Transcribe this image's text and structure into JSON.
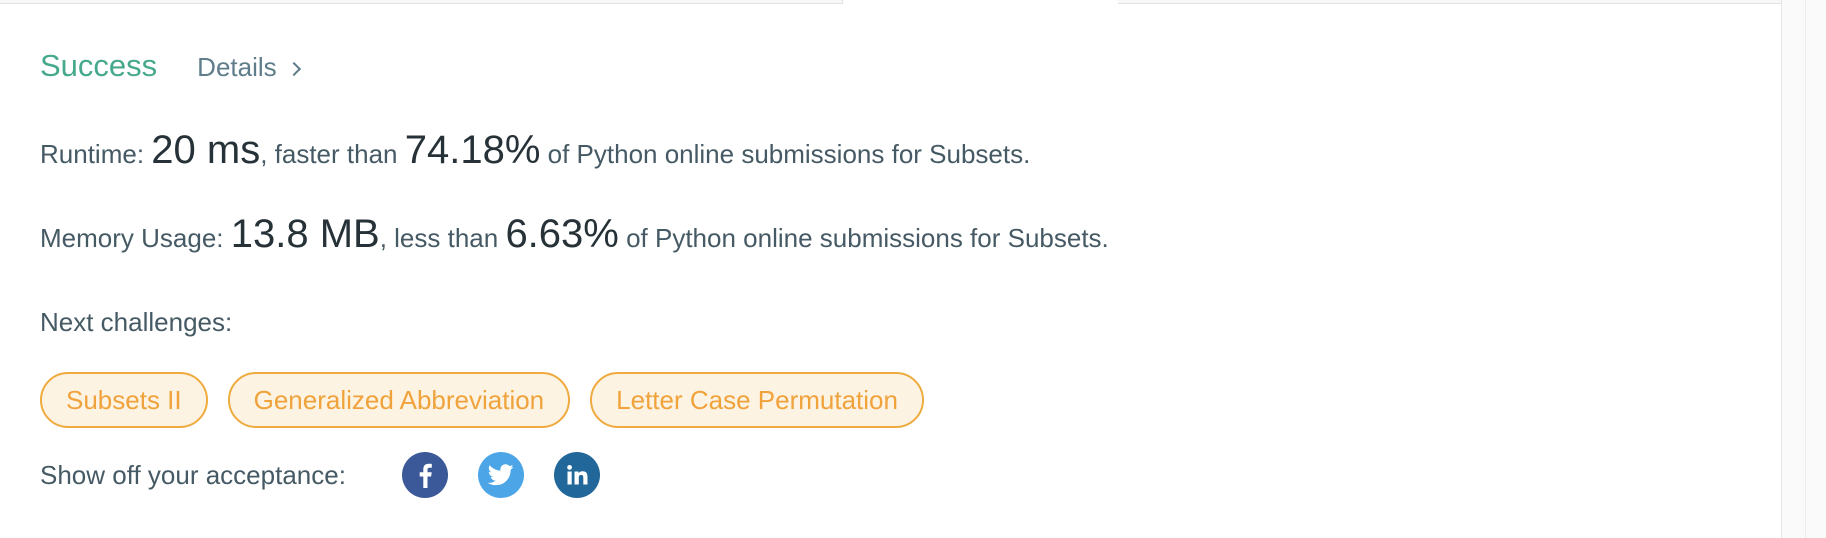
{
  "result": {
    "status": "Success",
    "details_label": "Details"
  },
  "runtime": {
    "label": "Runtime: ",
    "value": "20 ms",
    "comparison": ", faster than ",
    "percent": "74.18%",
    "suffix": " of Python online submissions for Subsets."
  },
  "memory": {
    "label": "Memory Usage: ",
    "value": "13.8 MB",
    "comparison": ", less than ",
    "percent": "6.63%",
    "suffix": " of Python online submissions for Subsets."
  },
  "next_challenges": {
    "label": "Next challenges:",
    "items": [
      "Subsets II",
      "Generalized Abbreviation",
      "Letter Case Permutation"
    ]
  },
  "share": {
    "label": "Show off your acceptance:",
    "icons": [
      "facebook-icon",
      "twitter-icon",
      "linkedin-icon"
    ]
  },
  "colors": {
    "success": "#46a98d",
    "challenge_border": "#efab3f",
    "challenge_fill": "#fdf3e3",
    "facebook": "#3b5998",
    "twitter": "#4ba5e6",
    "linkedin": "#22679a"
  }
}
